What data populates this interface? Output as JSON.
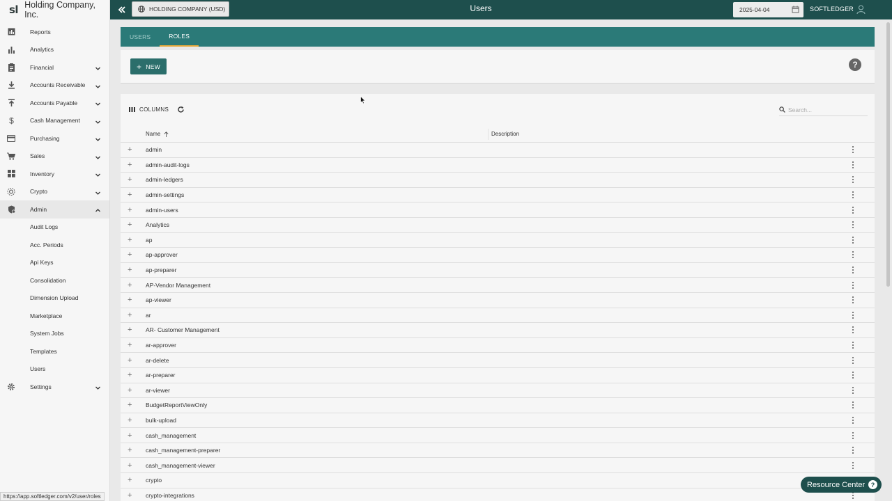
{
  "sidebar": {
    "logo": "sl",
    "company": "Holding Company, Inc.",
    "items": [
      {
        "label": "Reports",
        "icon": "reports-icon",
        "chevron": false
      },
      {
        "label": "Analytics",
        "icon": "analytics-icon",
        "chevron": false
      },
      {
        "label": "Financial",
        "icon": "financial-icon",
        "chevron": true
      },
      {
        "label": "Accounts Receivable",
        "icon": "download-icon",
        "chevron": true
      },
      {
        "label": "Accounts Payable",
        "icon": "upload-icon",
        "chevron": true
      },
      {
        "label": "Cash Management",
        "icon": "dollar-icon",
        "chevron": true
      },
      {
        "label": "Purchasing",
        "icon": "credit-card-icon",
        "chevron": true
      },
      {
        "label": "Sales",
        "icon": "cart-icon",
        "chevron": true
      },
      {
        "label": "Inventory",
        "icon": "inventory-icon",
        "chevron": true
      },
      {
        "label": "Crypto",
        "icon": "crypto-icon",
        "chevron": true
      },
      {
        "label": "Admin",
        "icon": "admin-shield-icon",
        "chevron": true,
        "expanded": true
      }
    ],
    "admin_sub": [
      "Audit Logs",
      "Acc. Periods",
      "Api Keys",
      "Consolidation",
      "Dimension Upload",
      "Marketplace",
      "System Jobs",
      "Templates",
      "Users"
    ],
    "settings": "Settings"
  },
  "topbar": {
    "entity": "HOLDING COMPANY (USD)",
    "title": "Users",
    "date": "2025-04-04",
    "user": "SOFTLEDGER"
  },
  "tabs": [
    {
      "label": "USERS",
      "active": false
    },
    {
      "label": "ROLES",
      "active": true
    }
  ],
  "toolbar": {
    "new_label": "NEW"
  },
  "grid": {
    "columns_label": "COLUMNS",
    "search_placeholder": "Search...",
    "headers": {
      "name": "Name",
      "description": "Description"
    },
    "rows": [
      "admin",
      "admin-audit-logs",
      "admin-ledgers",
      "admin-settings",
      "admin-users",
      "Analytics",
      "ap",
      "ap-approver",
      "ap-preparer",
      "AP-Vendor Management",
      "ap-viewer",
      "ar",
      "AR- Customer Management",
      "ar-approver",
      "ar-delete",
      "ar-preparer",
      "ar-viewer",
      "BudgetReportViewOnly",
      "bulk-upload",
      "cash_management",
      "cash_management-preparer",
      "cash_management-viewer",
      "crypto",
      "crypto-integrations"
    ]
  },
  "resource_center": "Resource Center",
  "status_url": "https://app.softledger.com/v2/user/roles",
  "colors": {
    "topbar": "#1e4f4d",
    "tabs": "#2b7a78",
    "tab_indicator": "#e8a93a",
    "button": "#2b6e6b"
  }
}
